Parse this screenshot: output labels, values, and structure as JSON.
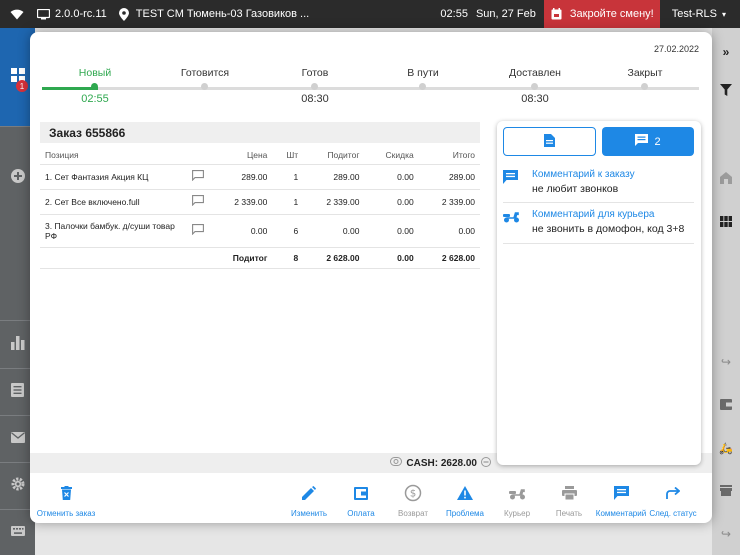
{
  "statusbar": {
    "version": "2.0.0-rc.11",
    "location": "TEST CM Тюмень-03 Газовиков ...",
    "time": "02:55",
    "date": "Sun, 27 Feb",
    "shift_button": "Закройте смену!",
    "user": "Test-RLS"
  },
  "sidebar": {
    "badge": "1"
  },
  "modal": {
    "date": "27.02.2022",
    "steps": [
      {
        "label": "Новый",
        "time": "02:55"
      },
      {
        "label": "Готовится",
        "time": ""
      },
      {
        "label": "Готов",
        "time": "08:30"
      },
      {
        "label": "В пути",
        "time": ""
      },
      {
        "label": "Доставлен",
        "time": "08:30"
      },
      {
        "label": "Закрыт",
        "time": ""
      }
    ],
    "order_title": "Заказ 655866",
    "columns": [
      "Позиция",
      "Цена",
      "Шт",
      "Подитог",
      "Скидка",
      "Итого"
    ],
    "rows": [
      {
        "name": "1. Сет Фантазия Акция КЦ",
        "price": "289.00",
        "qty": "1",
        "subtotal": "289.00",
        "discount": "0.00",
        "total": "289.00"
      },
      {
        "name": "2. Сет Все включено.full",
        "price": "2 339.00",
        "qty": "1",
        "subtotal": "2 339.00",
        "discount": "0.00",
        "total": "2 339.00"
      },
      {
        "name": "3. Палочки бамбук. д/суши товар РФ",
        "price": "0.00",
        "qty": "6",
        "subtotal": "0.00",
        "discount": "0.00",
        "total": "0.00"
      }
    ],
    "totals": {
      "label": "Подитог",
      "qty": "8",
      "subtotal": "2 628.00",
      "discount": "0.00",
      "total": "2 628.00"
    },
    "cash": "CASH: 2628.00"
  },
  "panel": {
    "comment_count": "2",
    "comments": [
      {
        "title": "Комментарий к заказу",
        "text": "не любит звонков",
        "icon": "comment-icon"
      },
      {
        "title": "Комментарий для курьера",
        "text": "не звонить в домофон, код 3+8",
        "icon": "scooter-icon"
      }
    ]
  },
  "actions": {
    "cancel": "Отменить заказ",
    "edit": "Изменить",
    "payment": "Оплата",
    "refund": "Возврат",
    "problem": "Проблема",
    "courier": "Курьер",
    "print": "Печать",
    "comment": "Комментарий",
    "next_status": "След. статус"
  },
  "colors": {
    "accent": "#1e88e5",
    "progress": "#2fa84f",
    "alert": "#c8343a"
  }
}
